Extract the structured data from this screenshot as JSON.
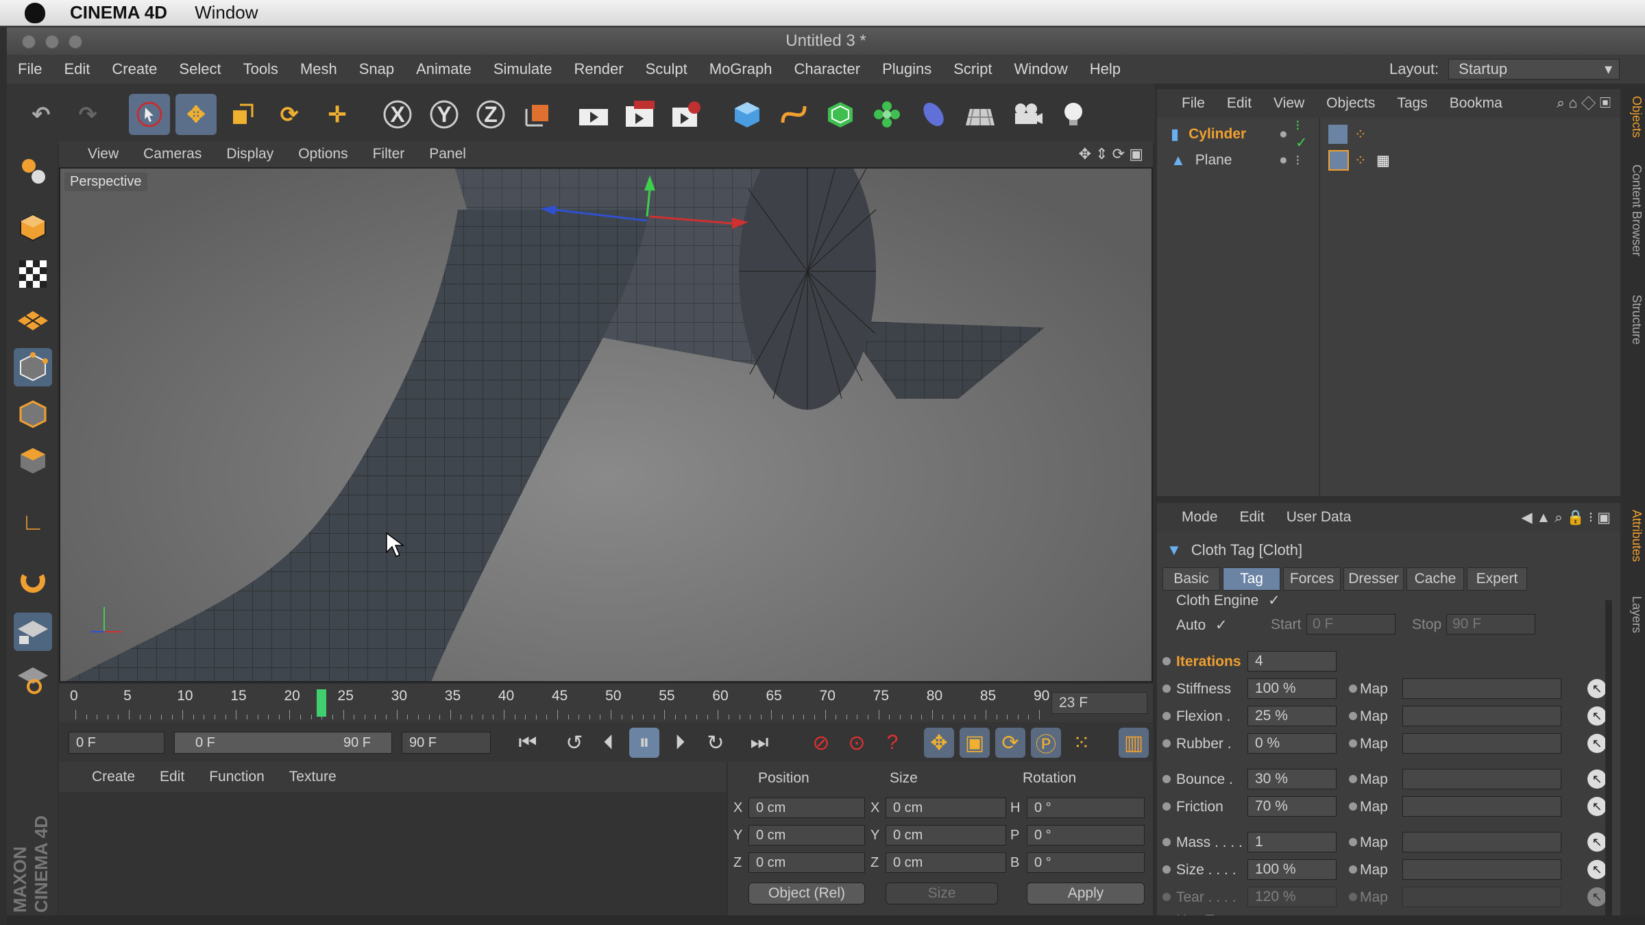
{
  "mac_menubar": {
    "app": "CINEMA 4D",
    "menu": "Window"
  },
  "window": {
    "title": "Untitled 3 *"
  },
  "main_menu": [
    "File",
    "Edit",
    "Create",
    "Select",
    "Tools",
    "Mesh",
    "Snap",
    "Animate",
    "Simulate",
    "Render",
    "Sculpt",
    "MoGraph",
    "Character",
    "Plugins",
    "Script",
    "Window",
    "Help"
  ],
  "layout": {
    "label": "Layout:",
    "value": "Startup"
  },
  "toolbar_icons": [
    "undo-icon",
    "redo-icon",
    "live-selection-icon",
    "move-icon",
    "scale-icon",
    "rotate-icon",
    "last-tool-icon",
    "x-axis-icon",
    "y-axis-icon",
    "z-axis-icon",
    "coordinate-system-icon",
    "render-view-icon",
    "render-picture-viewer-icon",
    "render-settings-icon",
    "cube-icon",
    "spline-icon",
    "subdivision-icon",
    "mograph-cloner-icon",
    "deformer-icon",
    "floor-icon",
    "camera-icon",
    "light-icon"
  ],
  "axis_letters": [
    "X",
    "Y",
    "Z"
  ],
  "viewport": {
    "menu": [
      "View",
      "Cameras",
      "Display",
      "Options",
      "Filter",
      "Panel"
    ],
    "label": "Perspective"
  },
  "timeline": {
    "ticks": [
      "0",
      "5",
      "10",
      "15",
      "20",
      "25",
      "30",
      "35",
      "40",
      "45",
      "50",
      "55",
      "60",
      "65",
      "70",
      "75",
      "80",
      "85",
      "90"
    ],
    "current_frame": "23 F",
    "playhead_frame": 23
  },
  "transport": {
    "start_field": "0 F",
    "range_start": "0 F",
    "range_end": "90 F",
    "end_field": "90 F"
  },
  "material_manager": {
    "menu": [
      "Create",
      "Edit",
      "Function",
      "Texture"
    ]
  },
  "coordinates": {
    "headers": {
      "position": "Position",
      "size": "Size",
      "rotation": "Rotation"
    },
    "rows": [
      {
        "axis": "X",
        "pos": "0 cm",
        "size_axis": "X",
        "size": "0 cm",
        "rot_axis": "H",
        "rot": "0 °"
      },
      {
        "axis": "Y",
        "pos": "0 cm",
        "size_axis": "Y",
        "size": "0 cm",
        "rot_axis": "P",
        "rot": "0 °"
      },
      {
        "axis": "Z",
        "pos": "0 cm",
        "size_axis": "Z",
        "size": "0 cm",
        "rot_axis": "B",
        "rot": "0 °"
      }
    ],
    "mode_select": "Object (Rel)",
    "size_select": "Size",
    "apply": "Apply"
  },
  "object_manager": {
    "menu": [
      "File",
      "Edit",
      "View",
      "Objects",
      "Tags",
      "Bookma"
    ],
    "objects": [
      {
        "name": "Cylinder",
        "selected": true
      },
      {
        "name": "Plane",
        "selected": false
      }
    ]
  },
  "attributes": {
    "menu": [
      "Mode",
      "Edit",
      "User Data"
    ],
    "title": "Cloth Tag [Cloth]",
    "tabs": [
      "Basic",
      "Tag",
      "Forces",
      "Dresser",
      "Cache",
      "Expert"
    ],
    "active_tab": "Tag",
    "cloth_engine": "Cloth Engine",
    "auto": "Auto",
    "start_label": "Start",
    "start_value": "0 F",
    "stop_label": "Stop",
    "stop_value": "90 F",
    "params": [
      {
        "label": "Iterations",
        "value": "4",
        "map": false
      },
      {
        "label": "Stiffness",
        "value": "100 %",
        "map": true
      },
      {
        "label": "Flexion .",
        "value": "25 %",
        "map": true
      },
      {
        "label": "Rubber .",
        "value": "0 %",
        "map": true
      },
      {
        "label": "Bounce .",
        "value": "30 %",
        "map": true
      },
      {
        "label": "Friction",
        "value": "70 %",
        "map": true
      },
      {
        "label": "Mass . . . .",
        "value": "1",
        "map": true
      },
      {
        "label": "Size . . . .",
        "value": "100 %",
        "map": true
      },
      {
        "label": "Tear . . . .",
        "value": "120 %",
        "map": true
      },
      {
        "label": "Use Tear",
        "value": "",
        "map": false
      }
    ],
    "map_label": "Map"
  },
  "side_tabs": [
    "Objects",
    "Content Browser",
    "Structure",
    "Attributes",
    "Layers"
  ],
  "brand": "MAXON CINEMA 4D",
  "colors": {
    "accent": "#6b84a3",
    "iterations": "#f0a030",
    "cylinder": "#f0a030"
  }
}
